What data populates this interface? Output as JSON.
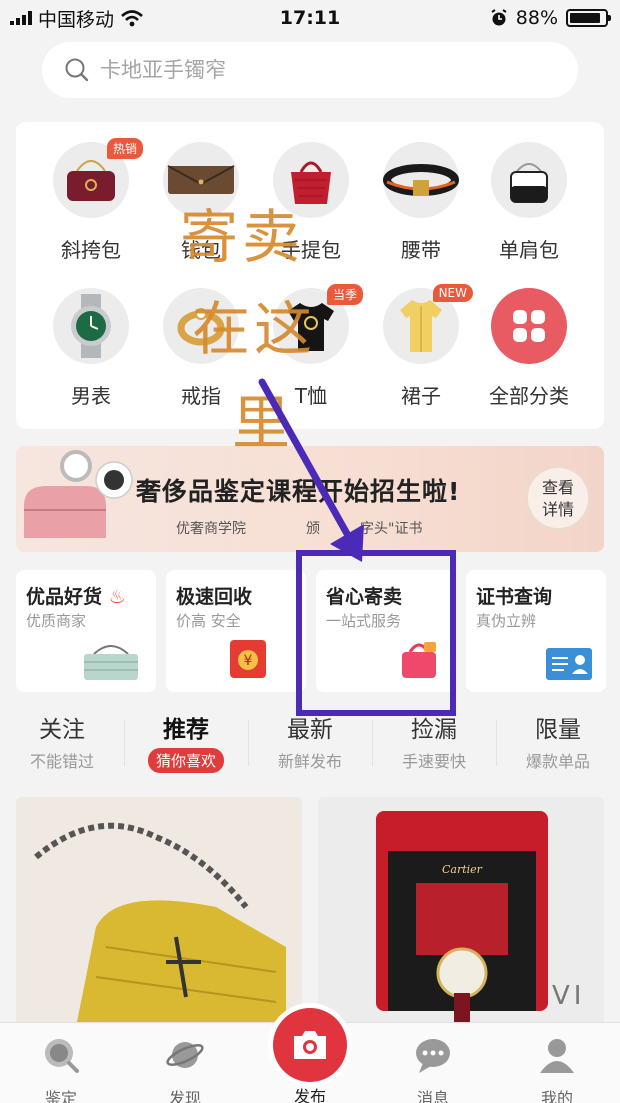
{
  "status_bar": {
    "carrier": "中国移动",
    "time": "17:11",
    "battery": "88%",
    "battery_level": 0.88
  },
  "search": {
    "placeholder": "卡地亚手镯窄"
  },
  "categories": [
    {
      "label": "斜挎包",
      "tag": "热销",
      "icon": "crossbody-bag-icon"
    },
    {
      "label": "钱包",
      "tag": "",
      "icon": "wallet-icon"
    },
    {
      "label": "手提包",
      "tag": "",
      "icon": "handbag-icon"
    },
    {
      "label": "腰带",
      "tag": "",
      "icon": "belt-icon"
    },
    {
      "label": "单肩包",
      "tag": "",
      "icon": "shoulder-bag-icon"
    },
    {
      "label": "男表",
      "tag": "",
      "icon": "watch-icon"
    },
    {
      "label": "戒指",
      "tag": "",
      "icon": "ring-icon"
    },
    {
      "label": "T恤",
      "tag": "当季",
      "icon": "tshirt-icon"
    },
    {
      "label": "裙子",
      "tag": "NEW",
      "icon": "dress-icon"
    },
    {
      "label": "全部分类",
      "tag": "",
      "icon": "all-categories-icon"
    }
  ],
  "banner": {
    "headline": "奢侈品鉴定课程开始招生啦!",
    "sub1": "优奢商学院",
    "sub2": "颁",
    "sub3": "字头\"证书",
    "button": "查看详情",
    "button_line1": "查看",
    "button_line2": "详情"
  },
  "services": [
    {
      "title": "优品好货",
      "sub": "优质商家",
      "icon": "fire-icon"
    },
    {
      "title": "极速回收",
      "sub": "价高 安全",
      "icon": "money-envelope-icon"
    },
    {
      "title": "省心寄卖",
      "sub": "一站式服务",
      "icon": "consign-bag-icon"
    },
    {
      "title": "证书查询",
      "sub": "真伪立辨",
      "icon": "certificate-icon"
    }
  ],
  "tabs": [
    {
      "title": "关注",
      "sub": "不能错过"
    },
    {
      "title": "推荐",
      "sub": "猜你喜欢"
    },
    {
      "title": "最新",
      "sub": "新鲜发布"
    },
    {
      "title": "捡漏",
      "sub": "手速要快"
    },
    {
      "title": "限量",
      "sub": "爆款单品"
    }
  ],
  "products": {
    "right_brand": "Cartier",
    "right_edge_text": "VI"
  },
  "nav": {
    "appraise": "鉴定",
    "discover": "发现",
    "publish": "发布",
    "messages": "消息",
    "mine": "我的"
  },
  "annotation": {
    "line1": "寄卖",
    "line2": "在这",
    "line3": "里"
  },
  "colors": {
    "accent": "#e0343f",
    "annotation_text": "#d68a2e",
    "highlight_box": "#4b2ab8"
  }
}
